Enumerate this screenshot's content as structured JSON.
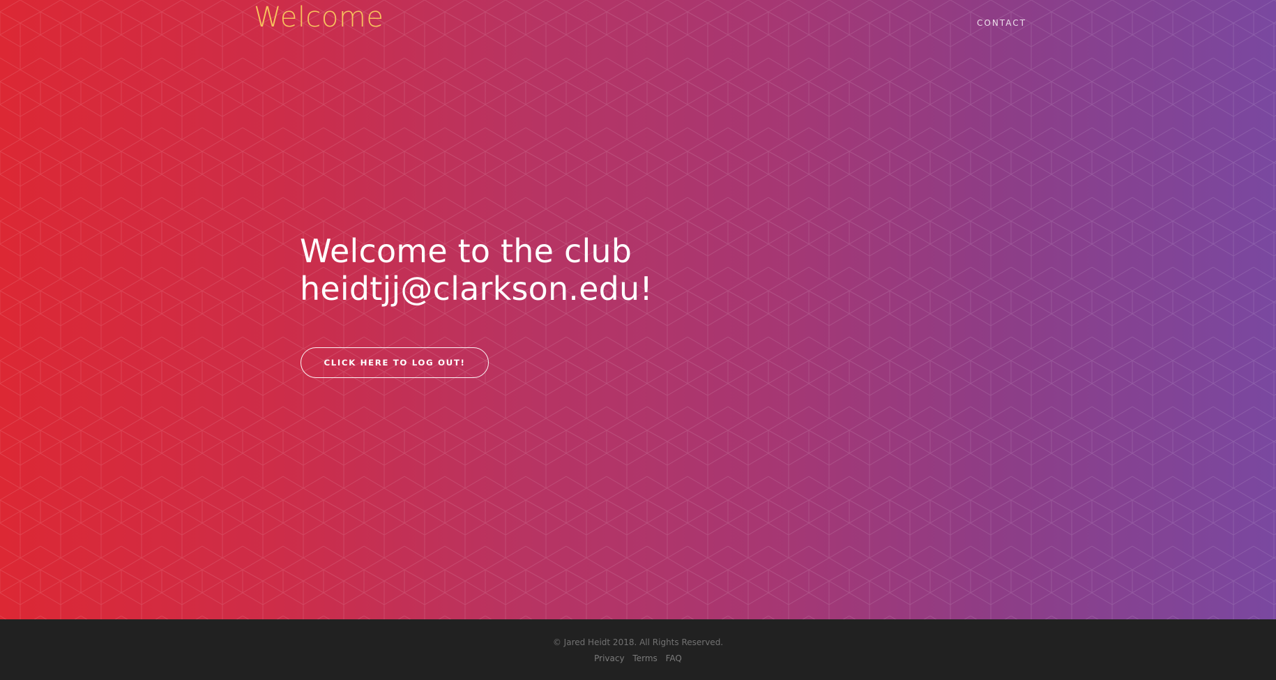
{
  "header": {
    "brand": "Welcome",
    "nav_contact": "CONTACT"
  },
  "hero": {
    "headline_line1": "Welcome to the club",
    "headline_line2": "heidtjj@clarkson.edu!",
    "logout_label": "CLICK HERE TO LOG OUT!"
  },
  "footer": {
    "copyright": "© Jared Heidt 2018. All Rights Reserved.",
    "links": [
      {
        "label": "Privacy"
      },
      {
        "label": "Terms"
      },
      {
        "label": "FAQ"
      }
    ]
  },
  "colors": {
    "gradient_start": "#dc2834",
    "gradient_mid": "#b73463",
    "gradient_end": "#7a48a0",
    "brand": "#f8c25e",
    "footer_bg": "#212121"
  }
}
